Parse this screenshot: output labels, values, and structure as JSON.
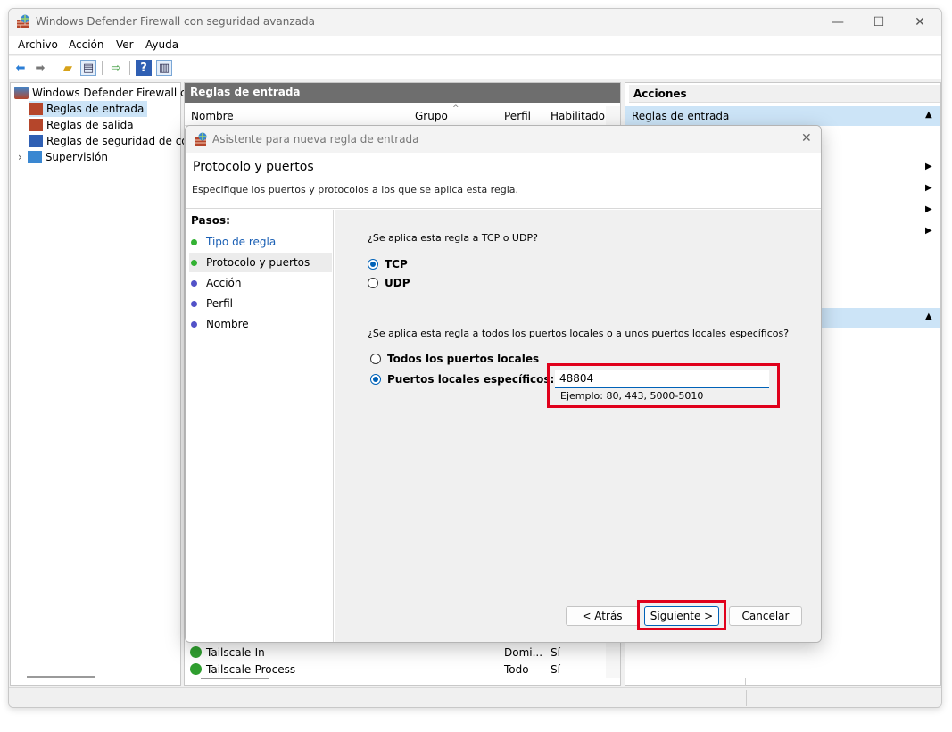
{
  "window": {
    "title": "Windows Defender Firewall con seguridad avanzada",
    "controls": {
      "minimize": "—",
      "maximize": "☐",
      "close": "✕"
    }
  },
  "menu": [
    "Archivo",
    "Acción",
    "Ver",
    "Ayuda"
  ],
  "tree": {
    "root": "Windows Defender Firewall con",
    "items": [
      "Reglas de entrada",
      "Reglas de salida",
      "Reglas de seguridad de con",
      "Supervisión"
    ]
  },
  "center": {
    "header": "Reglas de entrada",
    "columns": [
      "Nombre",
      "Grupo",
      "Perfil",
      "Habilitado"
    ],
    "rows": [
      {
        "name": "Tailscale-In",
        "profile": "Domi...",
        "enabled": "Sí"
      },
      {
        "name": "Tailscale-Process",
        "profile": "Todo",
        "enabled": "Sí"
      }
    ]
  },
  "actions": {
    "header": "Acciones",
    "section": "Reglas de entrada"
  },
  "dialog": {
    "title": "Asistente para nueva regla de entrada",
    "heading": "Protocolo y puertos",
    "subheading": "Especifique los puertos y protocolos a los que se aplica esta regla.",
    "steps_label": "Pasos:",
    "steps": [
      "Tipo de regla",
      "Protocolo y puertos",
      "Acción",
      "Perfil",
      "Nombre"
    ],
    "question1": "¿Se aplica esta regla a TCP o UDP?",
    "protocol_options": [
      "TCP",
      "UDP"
    ],
    "question2": "¿Se aplica esta regla a todos los puertos locales o a unos puertos locales específicos?",
    "port_options": [
      "Todos los puertos locales",
      "Puertos locales específicos:"
    ],
    "port_value": "48804",
    "port_example": "Ejemplo: 80, 443, 5000-5010",
    "buttons": {
      "back": "< Atrás",
      "next": "Siguiente >",
      "cancel": "Cancelar"
    }
  },
  "colors": {
    "accent": "#0062b8",
    "highlight": "#e0001b",
    "header_gray": "#6e6e6e",
    "selection_blue": "#cce4f7"
  }
}
